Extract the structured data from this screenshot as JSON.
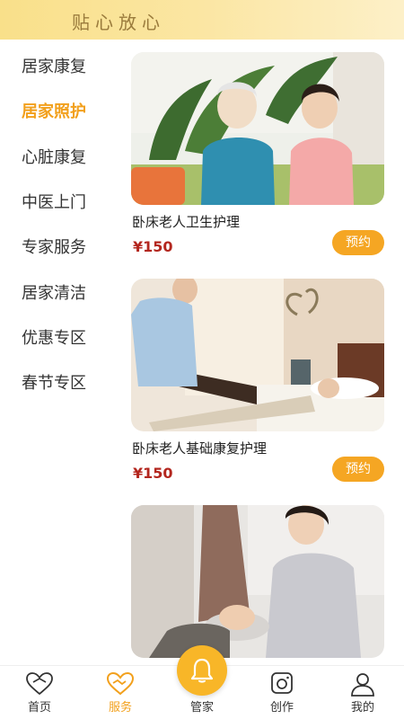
{
  "header": {
    "title": "贴心放心"
  },
  "sidebar": {
    "items": [
      {
        "label": "居家康复",
        "active": false
      },
      {
        "label": "居家照护",
        "active": true
      },
      {
        "label": "心脏康复",
        "active": false
      },
      {
        "label": "中医上门",
        "active": false
      },
      {
        "label": "专家服务",
        "active": false
      },
      {
        "label": "居家清洁",
        "active": false
      },
      {
        "label": "优惠专区",
        "active": false
      },
      {
        "label": "春节专区",
        "active": false
      }
    ]
  },
  "services": [
    {
      "title": "卧床老人卫生护理",
      "price": "¥150",
      "button": "预约"
    },
    {
      "title": "卧床老人基础康复护理",
      "price": "¥150",
      "button": "预约"
    }
  ],
  "tabbar": {
    "items": [
      {
        "label": "首页",
        "icon": "home-heart-icon"
      },
      {
        "label": "服务",
        "icon": "heart-handshake-icon",
        "active": true
      },
      {
        "label": "管家",
        "icon": "bell-icon"
      },
      {
        "label": "创作",
        "icon": "camera-icon"
      },
      {
        "label": "我的",
        "icon": "person-icon"
      }
    ]
  },
  "colors": {
    "accent": "#f5a623",
    "price": "#b3261e",
    "header": "#fbe6a3"
  }
}
